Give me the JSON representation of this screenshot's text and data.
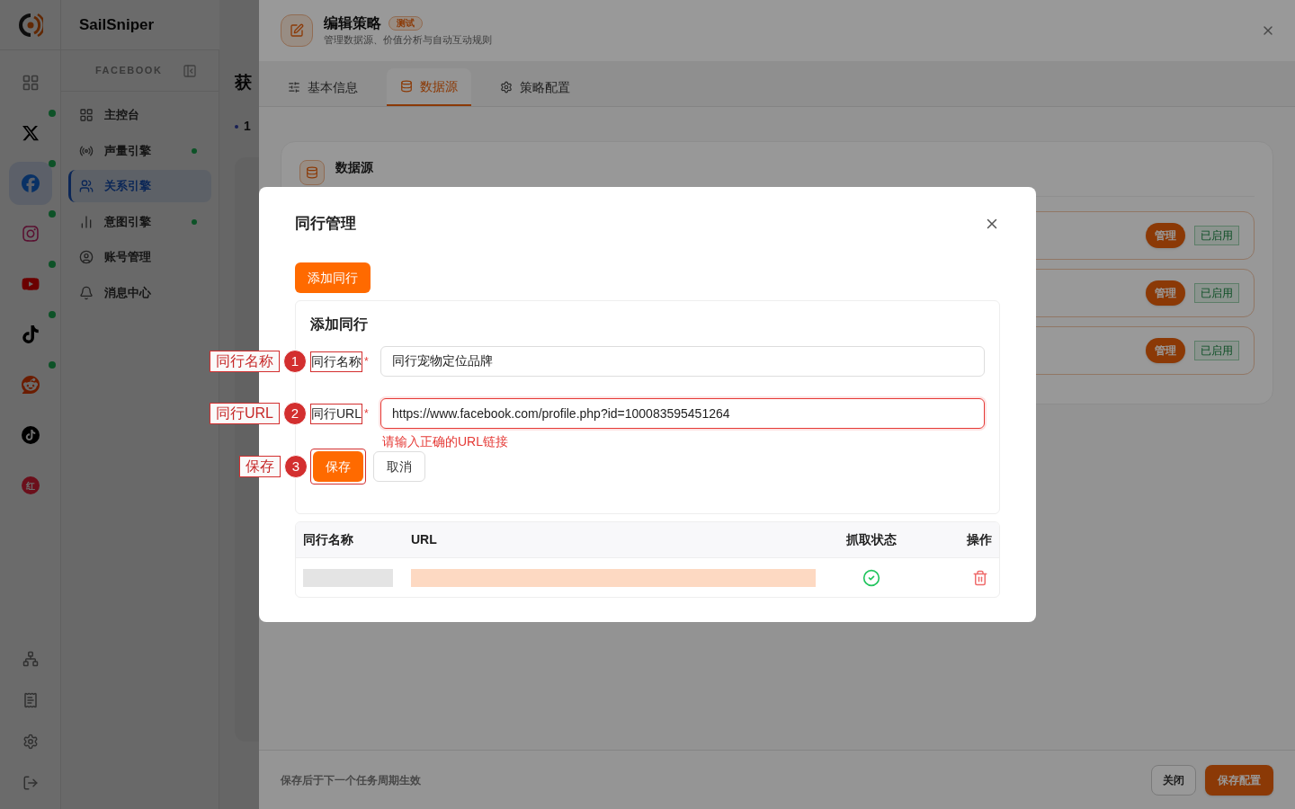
{
  "app": {
    "name": "SailSniper"
  },
  "platforms": [
    {
      "kind": "grid",
      "selected": false,
      "online": false
    },
    {
      "kind": "x",
      "selected": false,
      "online": true
    },
    {
      "kind": "facebook",
      "selected": true,
      "online": true
    },
    {
      "kind": "instagram",
      "selected": false,
      "online": true
    },
    {
      "kind": "youtube",
      "selected": false,
      "online": true
    },
    {
      "kind": "tiktok",
      "selected": false,
      "online": true
    },
    {
      "kind": "reddit",
      "selected": false,
      "online": true
    },
    {
      "kind": "tiktok-circle",
      "selected": false,
      "online": false
    },
    {
      "kind": "xiaohongshu",
      "selected": false,
      "online": false,
      "text": "红"
    }
  ],
  "rail_bottom": [
    {
      "kind": "network"
    },
    {
      "kind": "billing"
    },
    {
      "kind": "settings"
    },
    {
      "kind": "logout"
    }
  ],
  "nav": {
    "section": "FACEBOOK",
    "items": [
      {
        "label": "主控台",
        "kind": "dashboard",
        "selected": false,
        "online": false
      },
      {
        "label": "声量引擎",
        "kind": "radio",
        "selected": false,
        "online": true
      },
      {
        "label": "关系引擎",
        "kind": "users",
        "selected": true,
        "online": false
      },
      {
        "label": "意图引擎",
        "kind": "chart",
        "selected": false,
        "online": true
      },
      {
        "label": "账号管理",
        "kind": "account",
        "selected": false,
        "online": false
      },
      {
        "label": "消息中心",
        "kind": "bell",
        "selected": false,
        "online": false
      }
    ]
  },
  "main": {
    "title": "获",
    "step": "1"
  },
  "drawer": {
    "title": "编辑策略",
    "badge": "测试",
    "subtitle": "管理数据源、价值分析与自动互动规则",
    "tabs": [
      {
        "label": "基本信息",
        "kind": "sliders",
        "selected": false
      },
      {
        "label": "数据源",
        "kind": "database",
        "selected": true
      },
      {
        "label": "策略配置",
        "kind": "gear",
        "selected": false
      }
    ],
    "section_title": "数据源",
    "sources": [
      {
        "action": "管理",
        "status": "已启用"
      },
      {
        "action": "管理",
        "status": "已启用"
      },
      {
        "action": "管理",
        "status": "已启用"
      }
    ],
    "footer_note": "保存后于下一个任务周期生效",
    "buttons": [
      {
        "label": "关闭",
        "kind": "secondary"
      },
      {
        "label": "保存配置",
        "kind": "primary"
      }
    ]
  },
  "modal": {
    "title": "同行管理",
    "add_button": "添加同行",
    "form": {
      "title": "添加同行",
      "fields": [
        {
          "label": "同行名称",
          "required_mark": "*",
          "value": "同行宠物定位品牌",
          "annotation": {
            "number": "1",
            "label": "同行名称"
          }
        },
        {
          "label": "同行URL",
          "required_mark": "*",
          "value": "https://www.facebook.com/profile.php?id=100083595451264",
          "error": "请输入正确的URL链接",
          "annotation": {
            "number": "2",
            "label": "同行URL"
          }
        }
      ],
      "actions": [
        {
          "label": "保存",
          "kind": "primary",
          "annotation": {
            "number": "3",
            "label": "保存"
          }
        },
        {
          "label": "取消",
          "kind": "secondary"
        }
      ]
    },
    "table": {
      "columns": [
        "同行名称",
        "URL",
        "抓取状态",
        "操作"
      ],
      "rows": [
        {
          "scraped": true
        }
      ]
    }
  }
}
